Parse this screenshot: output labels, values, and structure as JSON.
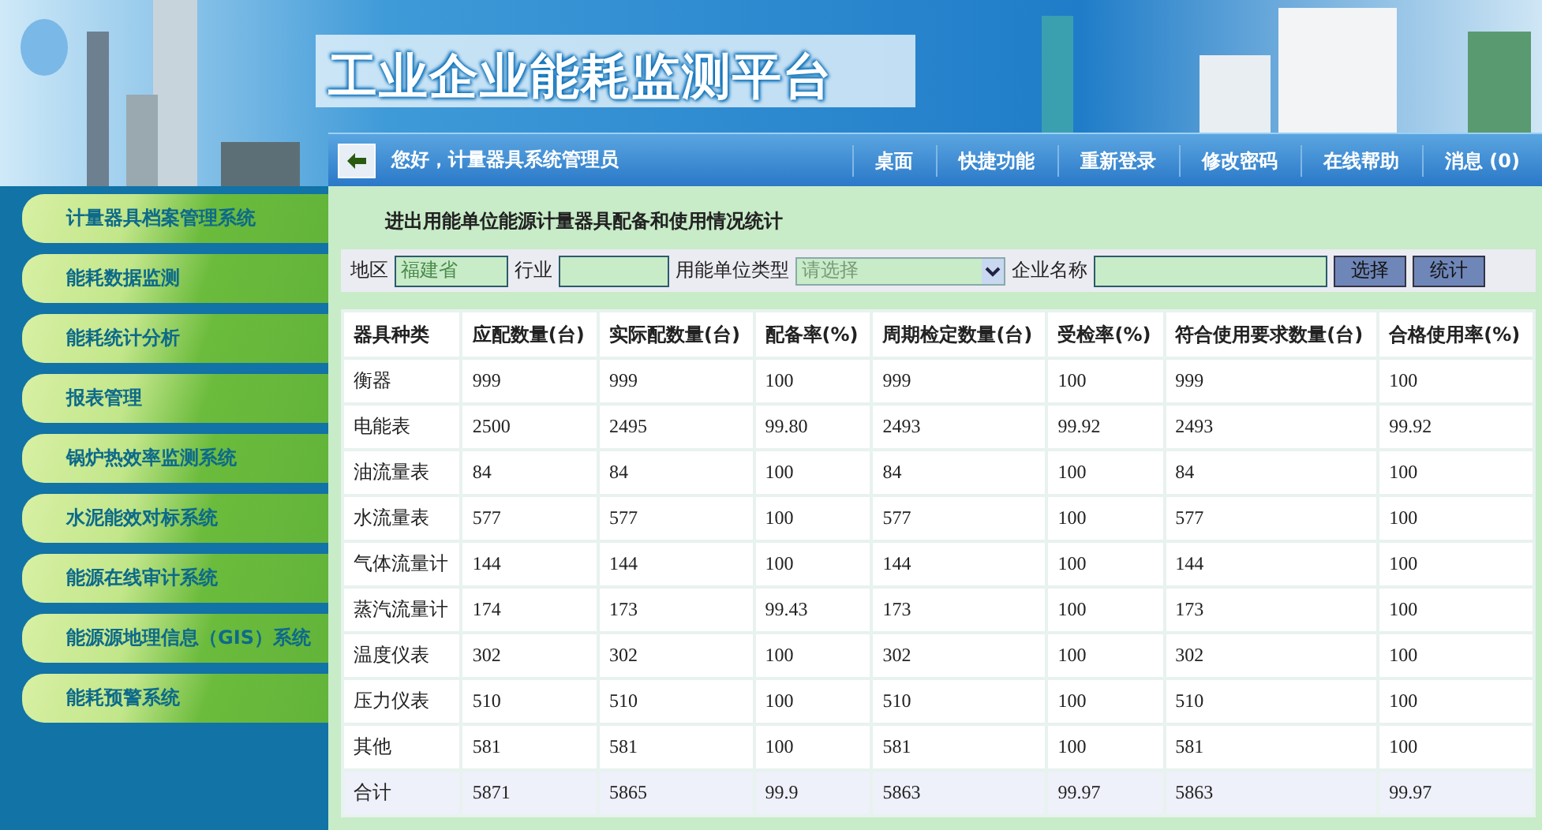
{
  "header": {
    "title": "工业企业能耗监测平台"
  },
  "nav_bar": {
    "greeting": "您好，计量器具系统管理员",
    "links": [
      "桌面",
      "快捷功能",
      "重新登录",
      "修改密码",
      "在线帮助",
      "消息 (0)"
    ]
  },
  "sidebar": {
    "items": [
      "计量器具档案管理系统",
      "能耗数据监测",
      "能耗统计分析",
      "报表管理",
      "锅炉热效率监测系统",
      "水泥能效对标系统",
      "能源在线审计系统",
      "能源源地理信息（GIS）系统",
      "能耗预警系统"
    ]
  },
  "report": {
    "title": "进出用能单位能源计量器具配备和使用情况统计"
  },
  "filters": {
    "region_label": "地区",
    "region_value": "福建省",
    "industry_label": "行业",
    "unit_type_label": "用能单位类型",
    "unit_type_value": "请选择",
    "company_label": "企业名称",
    "buttons": [
      "选择",
      "统计"
    ]
  },
  "table": {
    "columns": [
      "器具种类",
      "应配数量(台)",
      "实际配数量(台)",
      "配备率(%)",
      "周期检定数量(台)",
      "受检率(%)",
      "符合使用要求数量(台)",
      "合格使用率(%)"
    ],
    "rows": [
      [
        "衡器",
        "999",
        "999",
        "100",
        "999",
        "100",
        "999",
        "100"
      ],
      [
        "电能表",
        "2500",
        "2495",
        "99.80",
        "2493",
        "99.92",
        "2493",
        "99.92"
      ],
      [
        "油流量表",
        "84",
        "84",
        "100",
        "84",
        "100",
        "84",
        "100"
      ],
      [
        "水流量表",
        "577",
        "577",
        "100",
        "577",
        "100",
        "577",
        "100"
      ],
      [
        "气体流量计",
        "144",
        "144",
        "100",
        "144",
        "100",
        "144",
        "100"
      ],
      [
        "蒸汽流量计",
        "174",
        "173",
        "99.43",
        "173",
        "100",
        "173",
        "100"
      ],
      [
        "温度仪表",
        "302",
        "302",
        "100",
        "302",
        "100",
        "302",
        "100"
      ],
      [
        "压力仪表",
        "510",
        "510",
        "100",
        "510",
        "100",
        "510",
        "100"
      ],
      [
        "其他",
        "581",
        "581",
        "100",
        "581",
        "100",
        "581",
        "100"
      ]
    ],
    "total": [
      "合计",
      "5871",
      "5865",
      "99.9",
      "5863",
      "99.97",
      "5863",
      "99.97"
    ]
  }
}
